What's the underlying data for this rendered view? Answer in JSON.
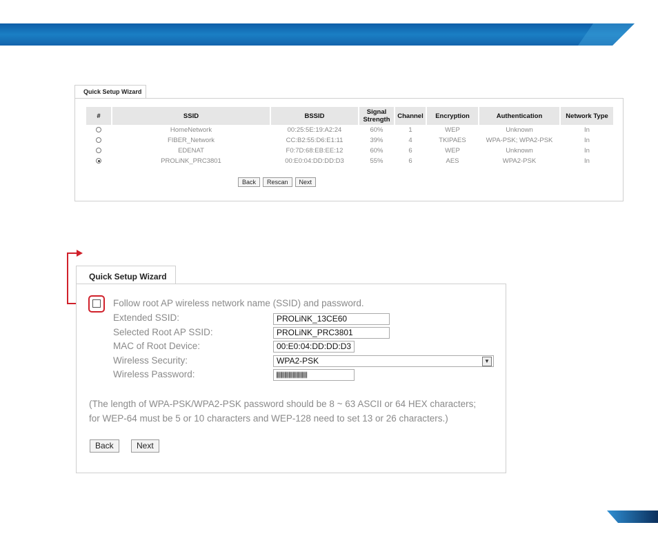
{
  "colors": {
    "banner": "#1a7fc4",
    "accent_red": "#d0202a",
    "header_bg": "#e6e6e6"
  },
  "wizard1": {
    "tab_title": "Quick Setup Wizard",
    "columns": [
      "#",
      "SSID",
      "BSSID",
      "Signal Strength",
      "Channel",
      "Encryption",
      "Authentication",
      "Network Type"
    ],
    "rows": [
      {
        "selected": false,
        "ssid": "HomeNetwork",
        "bssid": "00:25:5E:19:A2:24",
        "signal": "60%",
        "channel": "1",
        "encryption": "WEP",
        "authentication": "Unknown",
        "network_type": "In"
      },
      {
        "selected": false,
        "ssid": "FIBER_Network",
        "bssid": "CC:B2:55:D6:E1:11",
        "signal": "39%",
        "channel": "4",
        "encryption": "TKIPAES",
        "authentication": "WPA-PSK; WPA2-PSK",
        "network_type": "In"
      },
      {
        "selected": false,
        "ssid": "EDENAT",
        "bssid": "F0:7D:68:EB:EE:12",
        "signal": "60%",
        "channel": "6",
        "encryption": "WEP",
        "authentication": "Unknown",
        "network_type": "In"
      },
      {
        "selected": true,
        "ssid": "PROLiNK_PRC3801",
        "bssid": "00:E0:04:DD:DD:D3",
        "signal": "55%",
        "channel": "6",
        "encryption": "AES",
        "authentication": "WPA2-PSK",
        "network_type": "In"
      }
    ],
    "buttons": {
      "back": "Back",
      "rescan": "Rescan",
      "next": "Next"
    }
  },
  "wizard2": {
    "tab_title": "Quick Setup Wizard",
    "follow_label": "Follow root AP wireless network name (SSID) and password.",
    "follow_checked": false,
    "fields": {
      "extended_ssid": {
        "label": "Extended SSID:",
        "value": "PROLiNK_13CE60"
      },
      "root_ssid": {
        "label": "Selected Root AP SSID:",
        "value": "PROLiNK_PRC3801"
      },
      "root_mac": {
        "label": "MAC of Root Device:",
        "value": "00:E0:04:DD:DD:D3"
      },
      "security": {
        "label": "Wireless Security:",
        "value": "WPA2-PSK"
      },
      "password": {
        "label": "Wireless Password:"
      }
    },
    "note_line1": "(The length of WPA-PSK/WPA2-PSK password should be 8 ~ 63 ASCII or 64 HEX characters;",
    "note_line2": "for WEP-64 must be 5 or 10 characters and WEP-128 need to set 13 or 26 characters.)",
    "buttons": {
      "back": "Back",
      "next": "Next"
    }
  }
}
